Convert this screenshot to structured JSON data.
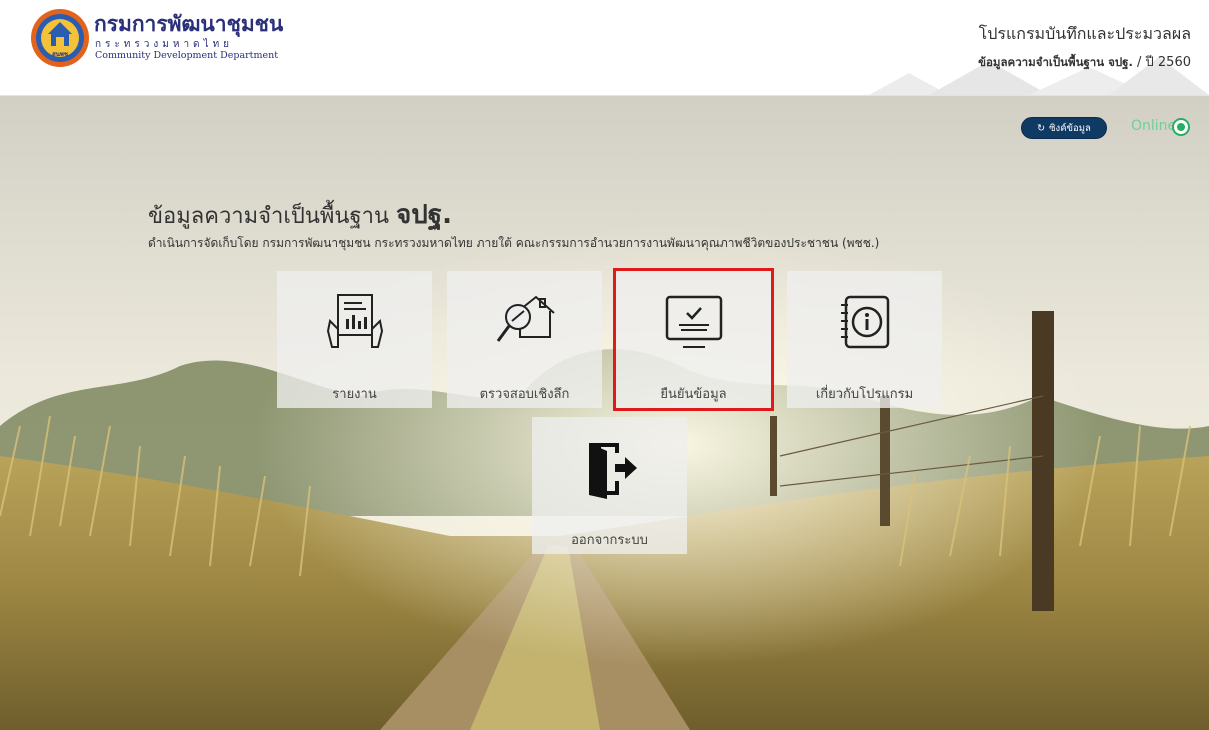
{
  "header": {
    "org_name_th": "กรมการพัฒนาชุมชน",
    "org_ministry_th": "กระทรวงมหาดไทย",
    "org_name_en": "Community Development Department",
    "program_name": "โปรแกรมบันทึกและประมวลผล",
    "program_dataset": "ข้อมูลความจำเป็นพื้นฐาน จปฐ.",
    "program_year": " / ปี 2560",
    "logo_text": "สนพช"
  },
  "status": {
    "sync_label": "ซิงค์ข้อมูล",
    "online_label": "Online",
    "online_color": "#27ae60"
  },
  "main": {
    "title_prefix": "ข้อมูลความจำเป็นพื้นฐาน ",
    "title_bold": "จปฐ.",
    "subtitle": "ดำเนินการจัดเก็บโดย กรมการพัฒนาชุมชน กระทรวงมหาดไทย ภายใต้ คณะกรรมการอำนวยการงานพัฒนาคุณภาพชีวิตของประชาชน (พชช.)"
  },
  "tiles": [
    {
      "label": "รายงาน",
      "icon": "report-icon"
    },
    {
      "label": "ตรวจสอบเชิงลึก",
      "icon": "house-inspect-icon"
    },
    {
      "label": "ยืนยันข้อมูล",
      "icon": "confirm-data-icon",
      "highlighted": true
    },
    {
      "label": "เกี่ยวกับโปรแกรม",
      "icon": "info-icon"
    },
    {
      "label": "ออกจากระบบ",
      "icon": "logout-icon"
    }
  ],
  "colors": {
    "brand_navy": "#2a2f7a",
    "sync_button": "#0f3a64",
    "highlight_border": "#e0191b"
  }
}
